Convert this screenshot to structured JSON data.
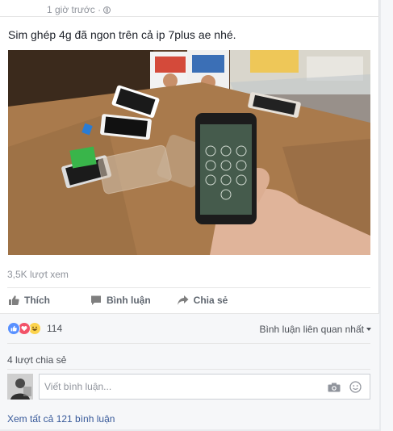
{
  "post": {
    "timestamp": "1 giờ trước ·",
    "text": "Sim ghép 4g đã ngon trên cả ip 7plus ae nhé.",
    "views": "3,5K lượt xem"
  },
  "actions": {
    "like_label": "Thích",
    "comment_label": "Bình luận",
    "share_label": "Chia sẻ"
  },
  "feedback": {
    "reaction_count": "114",
    "sort_label": "Bình luận liên quan nhất",
    "shares_label": "4 lượt chia sẻ",
    "comment_placeholder": "Viết bình luận...",
    "view_all_label": "Xem tất cả 121 bình luận"
  },
  "icons": {
    "like": "thumbs-up-icon",
    "comment": "speech-bubble-icon",
    "share": "share-arrow-icon",
    "camera": "camera-icon",
    "emoji": "smiley-icon",
    "privacy": "globe-icon"
  },
  "colors": {
    "link": "#365899",
    "like_reaction": "#5890ff",
    "love_reaction": "#f25268",
    "haha_reaction": "#fcd34d"
  }
}
